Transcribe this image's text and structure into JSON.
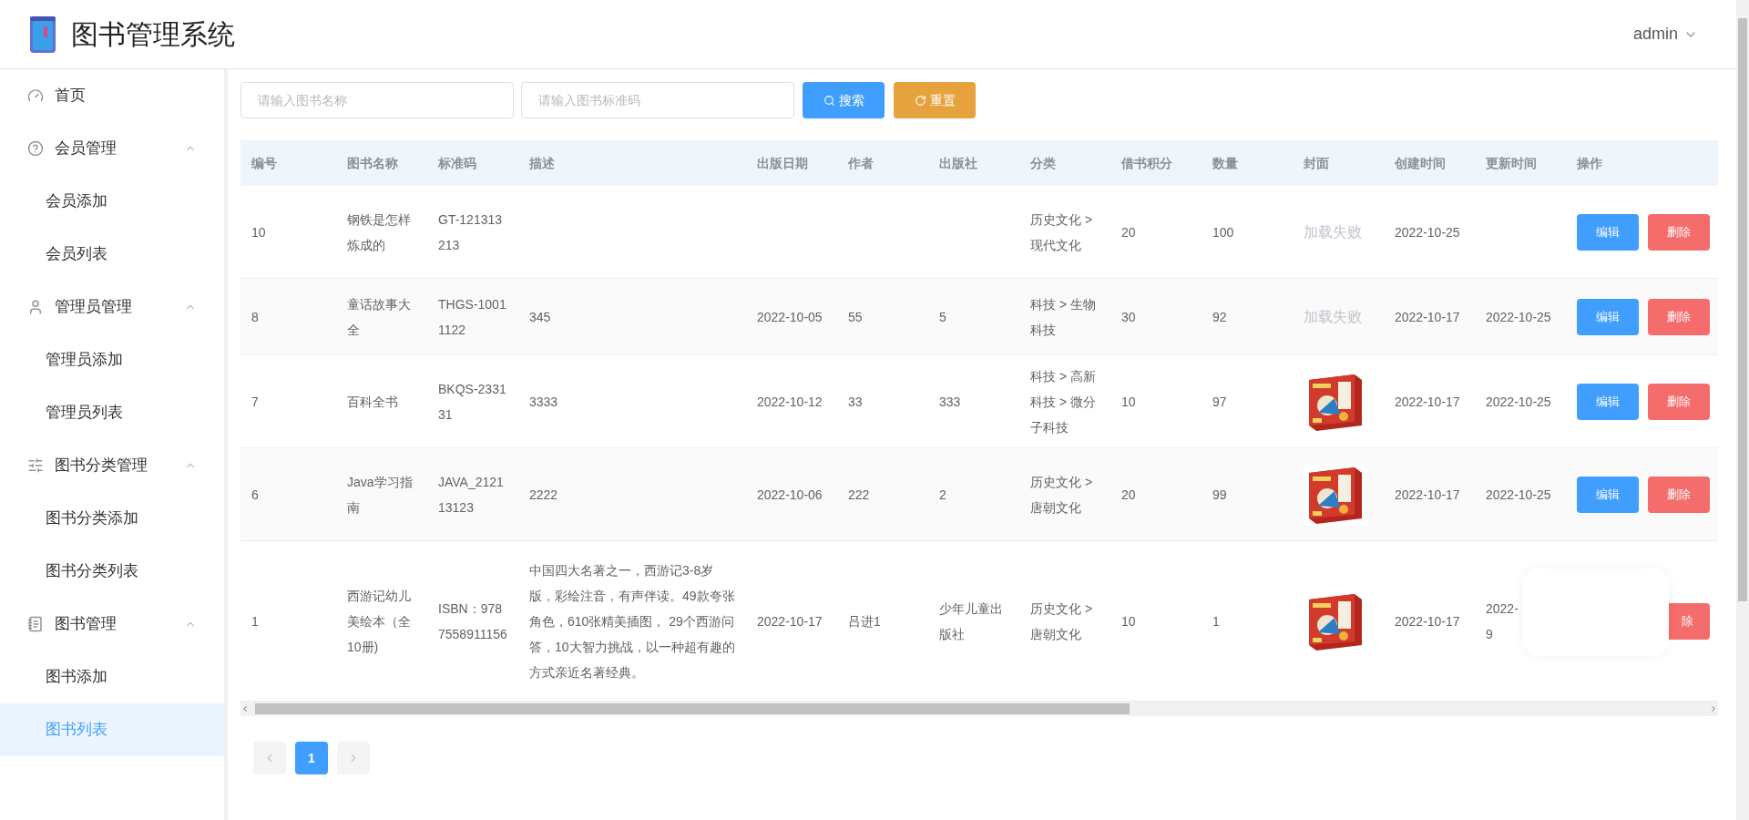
{
  "header": {
    "title": "图书管理系统",
    "user": "admin"
  },
  "sidebar": {
    "items": [
      {
        "kind": "item",
        "label": "首页",
        "selected": false
      },
      {
        "kind": "group",
        "label": "会员管理",
        "expanded": true,
        "children": [
          {
            "label": "会员添加",
            "selected": false
          },
          {
            "label": "会员列表",
            "selected": false
          }
        ]
      },
      {
        "kind": "group",
        "label": "管理员管理",
        "expanded": true,
        "children": [
          {
            "label": "管理员添加",
            "selected": false
          },
          {
            "label": "管理员列表",
            "selected": false
          }
        ]
      },
      {
        "kind": "group",
        "label": "图书分类管理",
        "expanded": true,
        "children": [
          {
            "label": "图书分类添加",
            "selected": false
          },
          {
            "label": "图书分类列表",
            "selected": false
          }
        ]
      },
      {
        "kind": "group",
        "label": "图书管理",
        "expanded": true,
        "children": [
          {
            "label": "图书添加",
            "selected": false
          },
          {
            "label": "图书列表",
            "selected": true
          }
        ]
      }
    ]
  },
  "search": {
    "name_placeholder": "请输入图书名称",
    "code_placeholder": "请输入图书标准码",
    "search_button": "搜索",
    "reset_button": "重置"
  },
  "table": {
    "columns": [
      "编号",
      "图书名称",
      "标准码",
      "描述",
      "出版日期",
      "作者",
      "出版社",
      "分类",
      "借书积分",
      "数量",
      "封面",
      "创建时间",
      "更新时间",
      "操作"
    ],
    "rows": [
      {
        "id": "10",
        "name": "钢铁是怎样炼成的",
        "code": "GT-121313213",
        "description": "",
        "publish_date": "",
        "author": "",
        "publisher": "",
        "category": "历史文化 > 现代文化",
        "points": "20",
        "quantity": "100",
        "cover": {
          "kind": "failed",
          "text": "加载失败"
        },
        "created": "2022-10-25",
        "updated": "",
        "actions": [
          {
            "kind": "edit",
            "label": "编辑"
          },
          {
            "kind": "delete",
            "label": "删除"
          }
        ]
      },
      {
        "id": "8",
        "name": "童话故事大全",
        "code": "THGS-10011122",
        "description": "345",
        "publish_date": "2022-10-05",
        "author": "55",
        "publisher": "5",
        "category": "科技 > 生物科技",
        "points": "30",
        "quantity": "92",
        "cover": {
          "kind": "failed",
          "text": "加载失败"
        },
        "created": "2022-10-17",
        "updated": "2022-10-25",
        "actions": [
          {
            "kind": "edit",
            "label": "编辑"
          },
          {
            "kind": "delete",
            "label": "删除"
          }
        ]
      },
      {
        "id": "7",
        "name": "百科全书",
        "code": "BKQS-233131",
        "description": "3333",
        "publish_date": "2022-10-12",
        "author": "33",
        "publisher": "333",
        "category": "科技 > 高新科技 > 微分子科技",
        "points": "10",
        "quantity": "97",
        "cover": {
          "kind": "picture"
        },
        "created": "2022-10-17",
        "updated": "2022-10-25",
        "actions": [
          {
            "kind": "edit",
            "label": "编辑"
          },
          {
            "kind": "delete",
            "label": "删除"
          }
        ]
      },
      {
        "id": "6",
        "name": "Java学习指南",
        "code": "JAVA_212113123",
        "description": "2222",
        "publish_date": "2022-10-06",
        "author": "222",
        "publisher": "2",
        "category": "历史文化 > 唐朝文化",
        "points": "20",
        "quantity": "99",
        "cover": {
          "kind": "picture"
        },
        "created": "2022-10-17",
        "updated": "2022-10-25",
        "actions": [
          {
            "kind": "edit",
            "label": "编辑"
          },
          {
            "kind": "delete",
            "label": "删除"
          }
        ]
      },
      {
        "id": "1",
        "name": "西游记幼儿美绘本（全10册)",
        "code": "ISBN：9787558911156",
        "description": "中国四大名著之一，西游记3-8岁版，彩绘注音，有声伴读。49款夸张角色，610张精美插图， 29个西游问答，10大智力挑战，以一种超有趣的方式亲近名著经典。",
        "publish_date": "2022-10-17",
        "author": "吕进1",
        "publisher": "少年儿童出版社",
        "category": "历史文化 > 唐朝文化",
        "points": "10",
        "quantity": "1",
        "cover": {
          "kind": "picture"
        },
        "created": "2022-10-17",
        "updated": "2022-\n9",
        "actions": [
          {
            "kind": "delete",
            "label": "除"
          }
        ],
        "overlay": true
      }
    ]
  },
  "pagination": {
    "pages": [
      {
        "label": "1",
        "selected": true
      }
    ]
  }
}
